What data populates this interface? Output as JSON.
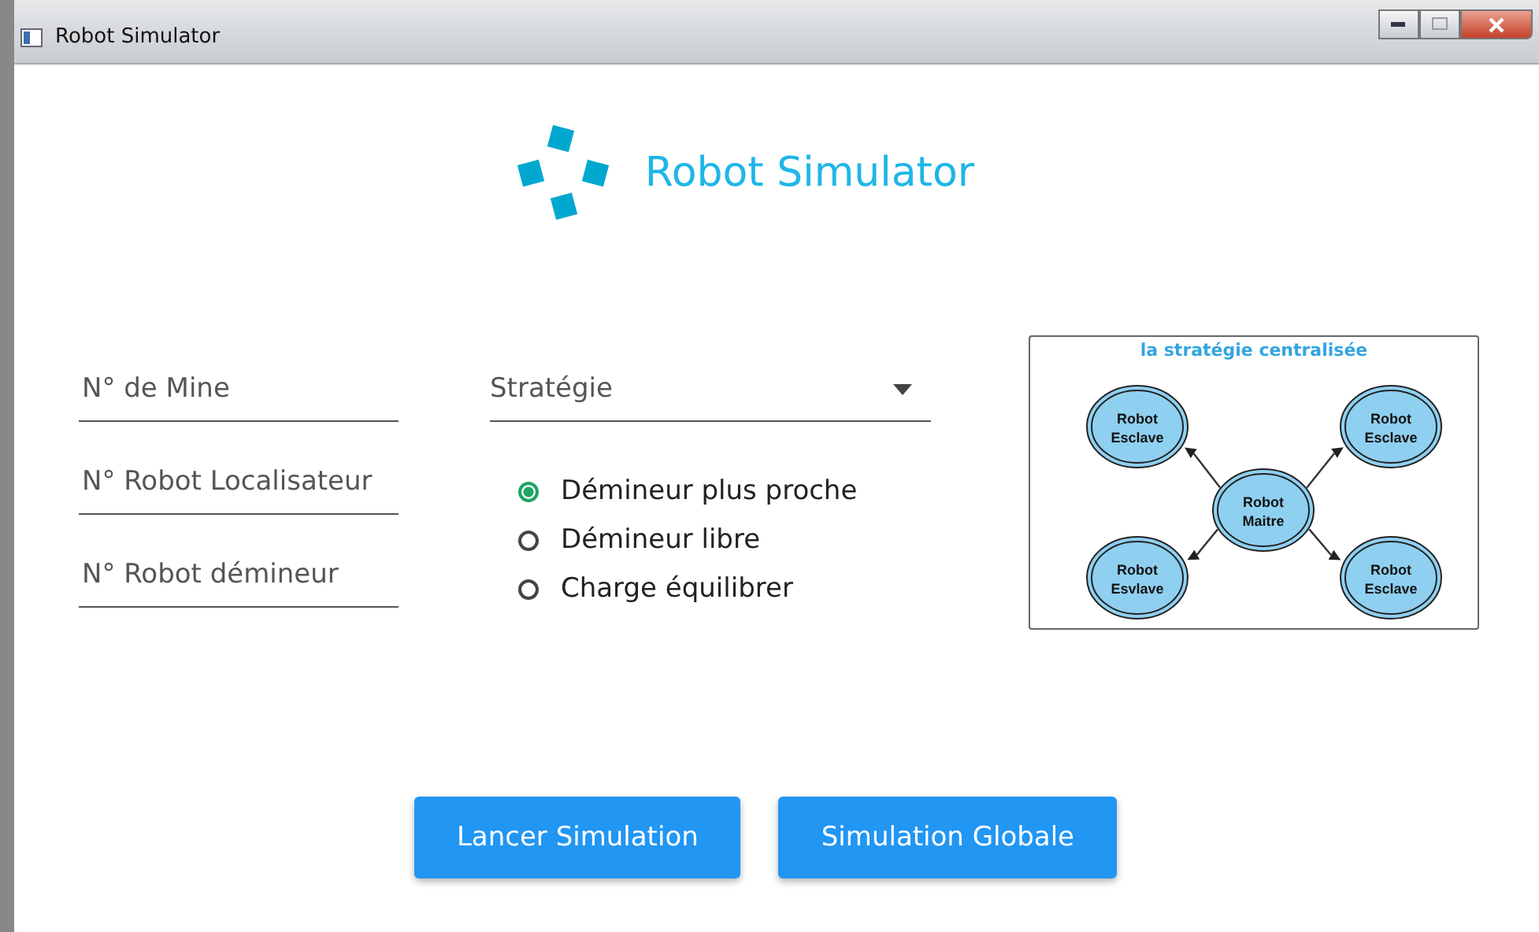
{
  "window": {
    "title": "Robot Simulator"
  },
  "header": {
    "title": "Robot Simulator"
  },
  "fields": [
    {
      "placeholder": "N° de Mine"
    },
    {
      "placeholder": "N° Robot Localisateur"
    },
    {
      "placeholder": "N° Robot démineur"
    }
  ],
  "strategy": {
    "placeholder": "Stratégie"
  },
  "options": [
    {
      "label": "Démineur plus proche",
      "selected": true
    },
    {
      "label": "Démineur libre",
      "selected": false
    },
    {
      "label": "Charge équilibrer",
      "selected": false
    }
  ],
  "diagram": {
    "title": "la stratégie centralisée",
    "center": {
      "lines": [
        "Robot",
        "Maitre"
      ]
    },
    "nodes": [
      {
        "lines": [
          "Robot",
          "Esclave"
        ]
      },
      {
        "lines": [
          "Robot",
          "Esclave"
        ]
      },
      {
        "lines": [
          "Robot",
          "Esvlave"
        ]
      },
      {
        "lines": [
          "Robot",
          "Esclave"
        ]
      }
    ]
  },
  "buttons": [
    "Lancer Simulation",
    "Simulation Globale"
  ]
}
